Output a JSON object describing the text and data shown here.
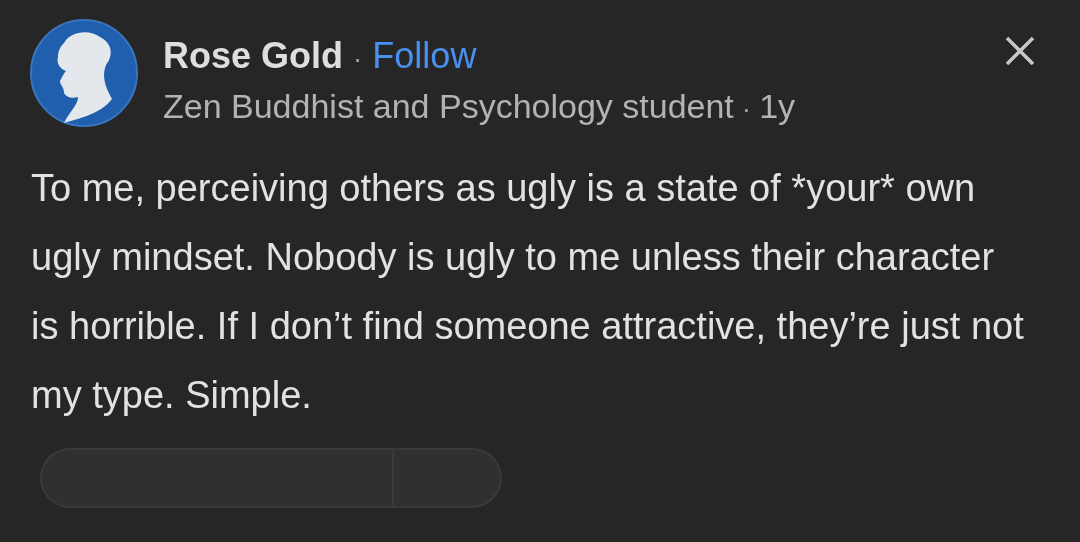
{
  "author": {
    "name": "Rose Gold",
    "separator": "·",
    "follow": "Follow",
    "credential": "Zen Buddhist and Psychology student",
    "time_separator": "·",
    "time": "1y"
  },
  "answer": {
    "text": "To me, perceiving others as ugly is a state of *your* own ugly mindset. Nobody is ugly to me unless their character is horrible. If I don’t find someone attractive, they’re just not my type. Simple."
  }
}
